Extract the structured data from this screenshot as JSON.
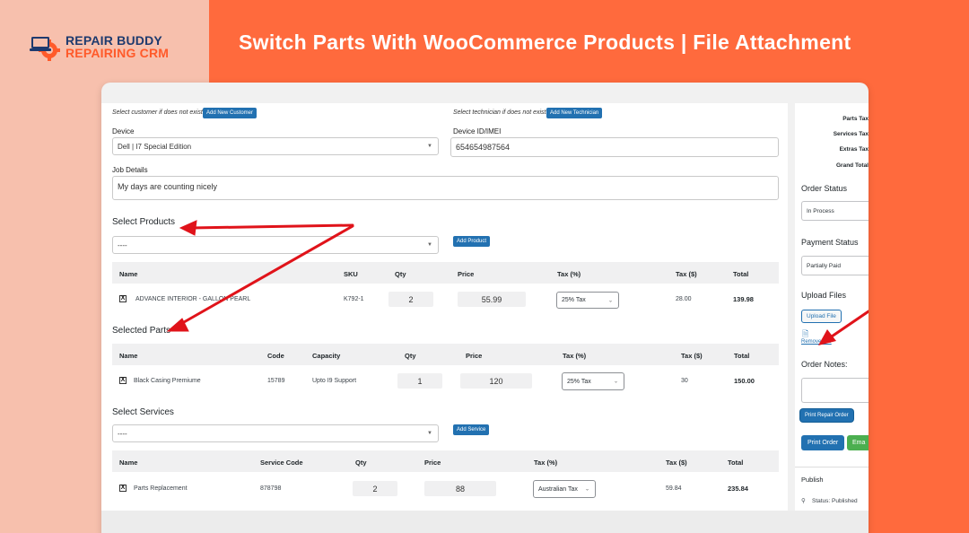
{
  "brand": {
    "line1": "REPAIR BUDDY",
    "line2": "REPAIRING CRM"
  },
  "headline": "Switch Parts With WooCommerce Products | File Attachment",
  "form": {
    "customer_hint": "Select customer if does not exist!",
    "add_customer_btn": "Add New Customer",
    "technician_hint": "Select technician if does not exist!",
    "add_technician_btn": "Add New Technician",
    "device_label": "Device",
    "device_value": "Dell | I7 Special Edition",
    "device_id_label": "Device ID/IMEI",
    "device_id_value": "654654987564",
    "job_details_label": "Job Details",
    "job_details_value": "My days are counting nicely"
  },
  "products": {
    "title": "Select Products",
    "select_value": "----",
    "add_btn": "Add Product",
    "headers": [
      "Name",
      "SKU",
      "Qty",
      "Price",
      "Tax (%)",
      "Tax ($)",
      "Total"
    ],
    "row": {
      "name": "ADVANCE INTERIOR - GALLON PEARL",
      "sku": "K792-1",
      "qty": "2",
      "price": "55.99",
      "tax_rate": "25% Tax",
      "tax_amount": "28.00",
      "total": "139.98"
    }
  },
  "parts": {
    "title": "Selected Parts",
    "headers": [
      "Name",
      "Code",
      "Capacity",
      "Qty",
      "Price",
      "Tax (%)",
      "Tax ($)",
      "Total"
    ],
    "row": {
      "name": "Black Casing Premiume",
      "code": "15789",
      "capacity": "Upto I9 Support",
      "qty": "1",
      "price": "120",
      "tax_rate": "25% Tax",
      "tax_amount": "30",
      "total": "150.00"
    }
  },
  "services": {
    "title": "Select Services",
    "select_value": "----",
    "add_btn": "Add Service",
    "headers": [
      "Name",
      "Service Code",
      "Qty",
      "Price",
      "Tax (%)",
      "Tax ($)",
      "Total"
    ],
    "row": {
      "name": "Parts Replacement",
      "code": "878798",
      "qty": "2",
      "price": "88",
      "tax_rate": "Australian Tax",
      "tax_amount": "59.84",
      "total": "235.84"
    }
  },
  "sidebar": {
    "parts_tax": "Parts Tax",
    "services_tax": "Services Tax",
    "extras_tax": "Extras Tax",
    "grand_total": "Grand Total",
    "order_status_title": "Order Status",
    "order_status_value": "In Process",
    "payment_status_title": "Payment Status",
    "payment_status_value": "Partially Paid",
    "upload_files_title": "Upload Files",
    "upload_btn": "Upload File",
    "remove_file": "Remove File",
    "order_notes_title": "Order Notes:",
    "print_repair_btn": "Print Repair Order",
    "print_order_btn": "Print Order",
    "email_btn": "Ema",
    "publish_title": "Publish",
    "status_text": "Status: Published"
  },
  "colors": {
    "accent": "#ff6a3d",
    "wp_blue": "#2271b1",
    "arrow": "#e0131a",
    "green": "#4caf50"
  }
}
